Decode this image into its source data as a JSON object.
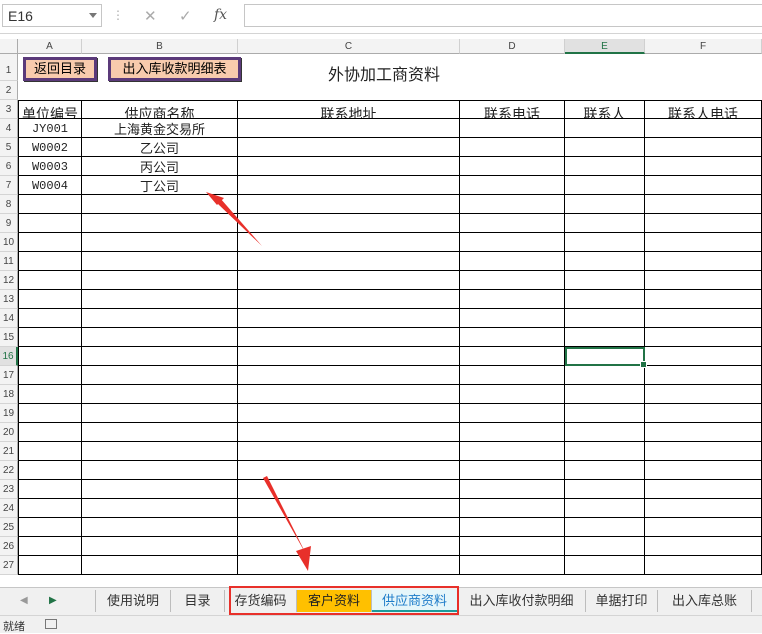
{
  "formula_bar": {
    "name_box": "E16",
    "cancel_icon": "cancel-x-icon",
    "enter_icon": "check-icon",
    "fx_label": "fx",
    "formula_value": ""
  },
  "columns": [
    "A",
    "B",
    "C",
    "D",
    "E",
    "F"
  ],
  "selected_column": "E",
  "selected_row": "16",
  "rows": [
    "1",
    "2",
    "3",
    "4",
    "5",
    "6",
    "7",
    "8",
    "9",
    "10",
    "11",
    "12",
    "13",
    "14",
    "15",
    "16",
    "17",
    "18",
    "19",
    "20",
    "21",
    "22",
    "23",
    "24",
    "25",
    "26",
    "27"
  ],
  "sheet": {
    "buttons": {
      "back": "返回目录",
      "detail": "出入库收款明细表"
    },
    "title": "外协加工商资料",
    "headers": [
      "单位编号",
      "供应商名称",
      "联系地址",
      "联系电话",
      "联系人",
      "联系人电话"
    ],
    "data_rows": [
      [
        "JY001",
        "上海黄金交易所",
        "",
        "",
        "",
        ""
      ],
      [
        "W0002",
        "乙公司",
        "",
        "",
        "",
        ""
      ],
      [
        "W0003",
        "丙公司",
        "",
        "",
        "",
        ""
      ],
      [
        "W0004",
        "丁公司",
        "",
        "",
        "",
        ""
      ]
    ]
  },
  "tabs": [
    {
      "label": "使用说明",
      "style": "normal"
    },
    {
      "label": "目录",
      "style": "normal"
    },
    {
      "label": "存货编码",
      "style": "normal"
    },
    {
      "label": "客户资料",
      "style": "orange"
    },
    {
      "label": "供应商资料",
      "style": "active"
    },
    {
      "label": "出入库收付款明细",
      "style": "normal"
    },
    {
      "label": "单据打印",
      "style": "normal"
    },
    {
      "label": "出入库总账",
      "style": "normal"
    }
  ],
  "status": {
    "text": "就绪"
  },
  "colors": {
    "accent_green": "#217346",
    "annotation_red": "#e8302a",
    "tab_orange": "#ffc000",
    "button_fill": "#f8cbad"
  }
}
